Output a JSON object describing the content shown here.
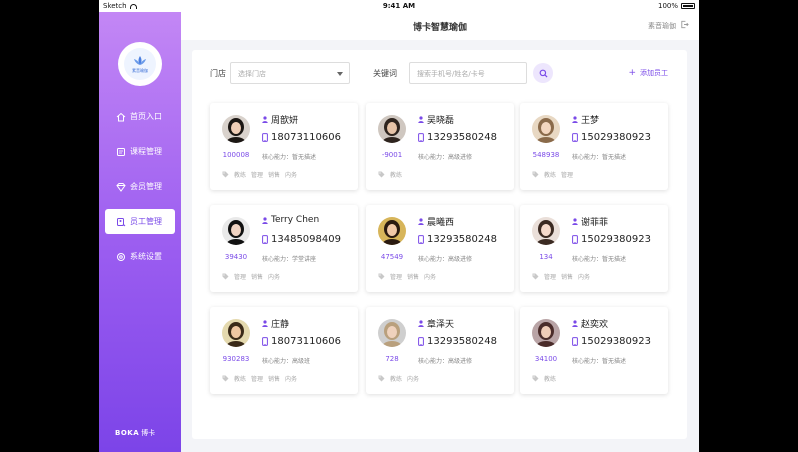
{
  "status_bar": {
    "carrier": "Sketch",
    "time": "9:41 AM",
    "battery": "100%"
  },
  "sidebar": {
    "logo_text": "素音瑜伽",
    "items": [
      {
        "label": "首页入口",
        "icon": "home-icon",
        "active": false
      },
      {
        "label": "课程管理",
        "icon": "course-icon",
        "active": false
      },
      {
        "label": "会员管理",
        "icon": "diamond-icon",
        "active": false
      },
      {
        "label": "员工管理",
        "icon": "staff-icon",
        "active": true
      },
      {
        "label": "系统设置",
        "icon": "settings-icon",
        "active": false
      }
    ],
    "brand_en": "BOKA",
    "brand_cn": "博卡"
  },
  "header": {
    "title": "博卡智慧瑜伽",
    "user": "素音瑜伽"
  },
  "filters": {
    "store_label": "门店",
    "store_placeholder": "选择门店",
    "keyword_label": "关键词",
    "keyword_placeholder": "搜索手机号/姓名/卡号",
    "add_label": "添加员工"
  },
  "colors": {
    "accent": "#7a4ae8",
    "sidebar_top": "#c387f5",
    "sidebar_bottom": "#7c44e8"
  },
  "staff": [
    {
      "name": "周歆妍",
      "phone": "18073110606",
      "id": "100008",
      "ability": "核心能力：暂无描述",
      "tags": [
        "教练",
        "管理",
        "销售",
        "内务"
      ]
    },
    {
      "name": "吴晓磊",
      "phone": "13293580248",
      "id": "-9001",
      "ability": "核心能力：高级进修",
      "tags": [
        "教练"
      ]
    },
    {
      "name": "王梦",
      "phone": "15029380923",
      "id": "548938",
      "ability": "核心能力：暂无描述",
      "tags": [
        "教练",
        "管理"
      ]
    },
    {
      "name": "Terry Chen",
      "phone": "13485098409",
      "id": "39430",
      "ability": "核心能力：学堂讲座",
      "tags": [
        "管理",
        "销售",
        "内务"
      ]
    },
    {
      "name": "晨曦西",
      "phone": "13293580248",
      "id": "47549",
      "ability": "核心能力：高级进修",
      "tags": [
        "管理",
        "销售",
        "内务"
      ]
    },
    {
      "name": "谢菲菲",
      "phone": "15029380923",
      "id": "134",
      "ability": "核心能力：暂无描述",
      "tags": [
        "管理",
        "销售",
        "内务"
      ]
    },
    {
      "name": "庄静",
      "phone": "18073110606",
      "id": "930283",
      "ability": "核心能力：高级班",
      "tags": [
        "教练",
        "管理",
        "销售",
        "内务"
      ]
    },
    {
      "name": "章泽天",
      "phone": "13293580248",
      "id": "728",
      "ability": "核心能力：高级进修",
      "tags": [
        "教练",
        "内务"
      ]
    },
    {
      "name": "赵奕欢",
      "phone": "15029380923",
      "id": "34100",
      "ability": "核心能力：暂无描述",
      "tags": [
        "教练"
      ]
    }
  ]
}
